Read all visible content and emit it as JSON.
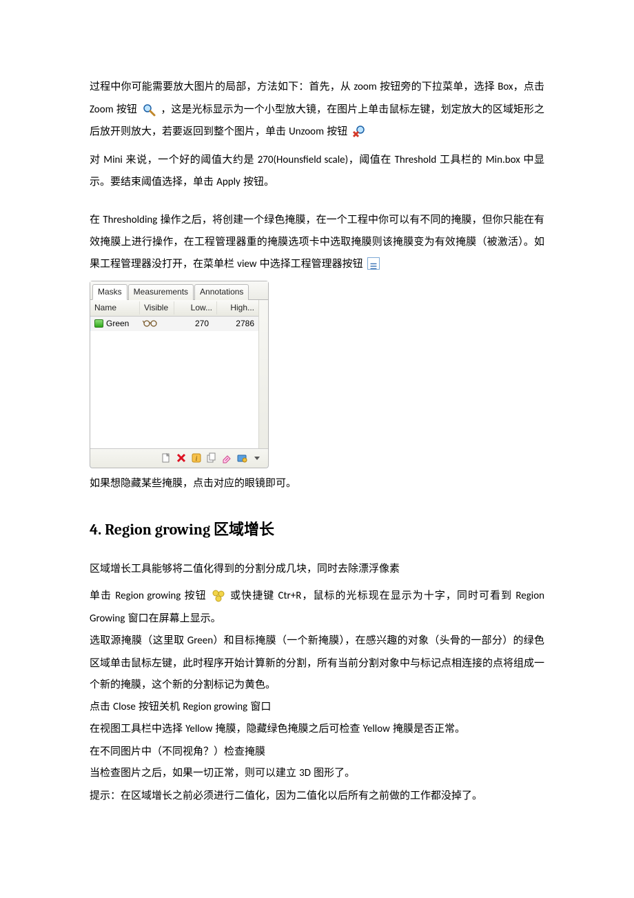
{
  "para1_pre": "过程中你可能需要放大图片的局部，方法如下：首先，从 ",
  "para1_l1": "zoom",
  "para1_mid1": " 按钮旁的下拉菜单，选择 ",
  "para1_l2": "Box",
  "para1_after": "，点击 ",
  "para1_l3": "Zoom",
  "para1_mid2": " 按钮 ",
  "para1_tail": "，这是光标显示为一个小型放大镜，在图片上单击鼠标左键，划定放大的区域矩形之后放开则放大，若要返回到整个图片，单击 ",
  "para1_l4": "Unzoom",
  "para1_mid3": " 按钮 ",
  "para2_pre": "对 ",
  "para2_l1": "Mini",
  "para2_mid1": " 来说，一个好的阈值大约是 ",
  "para2_l2": "270(Hounsfield scale)",
  "para2_mid2": "，阈值在 ",
  "para2_l3": "Threshold",
  "para2_mid3": " 工具栏的 ",
  "para2_l4": "Min.box",
  "para2_mid4": " 中显示。要结束阈值选择，单击 ",
  "para2_l5": "Apply",
  "para2_mid5": " 按钮。",
  "para3_pre": "在 ",
  "para3_l1": "Thresholding",
  "para3_mid1": " 操作之后，将创建一个绿色掩膜，在一个工程中你可以有不同的掩膜，但你只能在有效掩膜上进行操作，在工程管理器重的掩膜选项卡中选取掩膜则该掩膜变为有效掩膜（被激活）。如果工程管理器没打开，在菜单栏 ",
  "para3_l2": "view",
  "para3_mid2": " 中选择工程管理器按钮",
  "panel": {
    "tabs": {
      "masks": "Masks",
      "meas": "Measurements",
      "ann": "Annotations"
    },
    "headers": {
      "name": "Name",
      "vis": "Visible",
      "low": "Low...",
      "high": "High..."
    },
    "row": {
      "name": "Green",
      "low": "270",
      "high": "2786"
    }
  },
  "para4": "如果想隐藏某些掩膜，点击对应的眼镜即可。",
  "heading": "4. Region growing  区域增长",
  "para5": "区域增长工具能够将二值化得到的分割分成几块，同时去除漂浮像素",
  "para6_pre": "单击 ",
  "para6_l1": "Region growing",
  "para6_mid1": " 按钮",
  "para6_mid2": "或快捷键 ",
  "para6_l2": "Ctr+R",
  "para6_mid3": "，鼠标的光标现在显示为十字，同时可看到 ",
  "para6_l3": "Region Growing",
  "para6_mid4": " 窗口在屏幕上显示。",
  "para7_pre": "选取源掩膜（这里取 ",
  "para7_l1": "Green",
  "para7_mid": "）和目标掩膜（一个新掩膜），在感兴趣的对象（头骨的一部分）的绿色区域单击鼠标左键，此时程序开始计算新的分割，所有当前分割对象中与标记点相连接的点将组成一个新的掩膜，这个新的分割标记为黄色。",
  "para8_pre": "点击 ",
  "para8_l1": "Close",
  "para8_mid1": " 按钮关机 ",
  "para8_l2": "Region growing",
  "para8_mid2": "  窗口",
  "para9_pre": "在视图工具栏中选择 ",
  "para9_l1": "Yellow",
  "para9_mid1": " 掩膜，隐藏绿色掩膜之后可检查 ",
  "para9_l2": "Yellow",
  "para9_mid2": " 掩膜是否正常。",
  "para10": "在不同图片中（不同视角？）检查掩膜",
  "para11_pre": "当检查图片之后，如果一切正常，则可以建立 ",
  "para11_l1": "3D",
  "para11_mid": " 图形了。",
  "para12": "提示：在区域增长之前必须进行二值化，因为二值化以后所有之前做的工作都没掉了。"
}
